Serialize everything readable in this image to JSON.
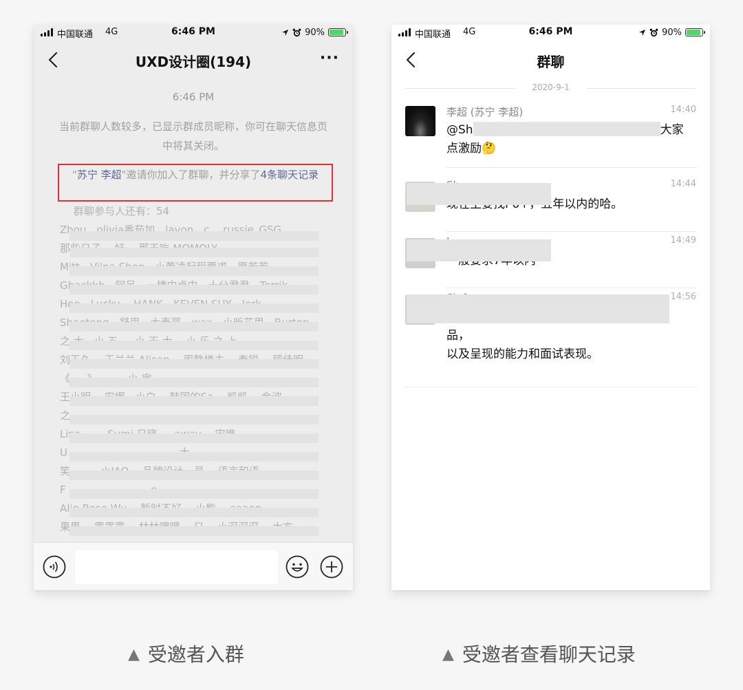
{
  "left_phone": {
    "status": {
      "carrier": "中国联通",
      "network": "4G",
      "time": "6:46 PM",
      "battery": "90%"
    },
    "nav": {
      "title": "UXD设计圈(194)",
      "more": "···"
    },
    "system_time": "6:46 PM",
    "system_notice": "当前群聊人数较多，已显示群成员昵称，你可在聊天信息页中将其关闭。",
    "invite": {
      "quote_open": "\"",
      "inviter": "苏宁 李超",
      "quote_close": "\"",
      "middle": "邀请你加入了群聊，并分享了",
      "link": "4条聊天记录"
    },
    "participants_label": "群聊参与人还有：54",
    "participants_rows": [
      "Zhou、olivia番茄加、lavon、c、 russie_GSG",
      "  那些日子、 奸、 那天吃 MOMOLY",
      "  Mitt、Vilna Shen、小蕾凌起程要求、愿若若、",
      "Gbackkh、阿呆、一楼中卓中、十分君君、Terrik",
      "  Hoo、Lucky、 HANK、KEVEN SUY、Jerk、",
      "Shaotong、舒思、大麦哥、wax、小昕花里、Burton",
      "  之 大、小 五 、 小 天 大、 小 乐 之 上",
      "刘玉久、 王兰兰 Alisan、 周静楼主、 秦锐、 顾佳明",
      "  《  、  》 、   、 小 宝  、  、 ",
      "   王小明、 安娜、小白、 韩国的Sa、 凯凯、 金波",
      "  之 、 、 、  、",
      "   Lisa、 、 Sumi 日晓 、 away、 宋唯",
      "U  、  、  、  、  、  、  、  、 大",
      "笑  、 、 小JAO 、品牌设计一号、 语言和语",
      "F  、 、 、  、  、  、 e",
      "  Alin Rose Wu、 暂时不好、 小熊、 aaaee",
      "果果、 露露露、 林林嘿嘿、 日、 小深深深、 大方"
    ]
  },
  "right_phone": {
    "status": {
      "carrier": "中国联通",
      "network": "4G",
      "time": "6:46 PM",
      "battery": "90%"
    },
    "nav": {
      "title": "群聊"
    },
    "date": "2020-9-1",
    "messages": [
      {
        "sender": "李超 (苏宁 李超)",
        "time": "14:40",
        "line1_start": "@Sh",
        "line1_end": "大家",
        "line2": "点激励🤔"
      },
      {
        "sender": "Sh  ",
        "time": "14:44",
        "line1": "现在主要找P6+，五年以内的哈。"
      },
      {
        "sender": "L",
        "time": "14:49",
        "line1": "一般要求7年以内"
      },
      {
        "sender": "Sh  f",
        "time": "14:56",
        "line1_end": "品，",
        "line2": "以及呈现的能力和面试表现。"
      }
    ]
  },
  "captions": {
    "left": "受邀者入群",
    "right": "受邀者查看聊天记录",
    "marker": "▲"
  },
  "colors": {
    "highlight_border": "#e03030",
    "link_blue": "#5b6b95",
    "battery_green": "#4cd964"
  }
}
